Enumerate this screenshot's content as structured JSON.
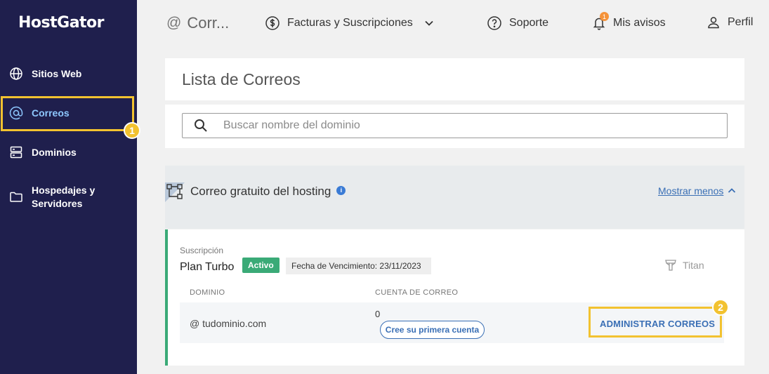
{
  "sidebar": {
    "logo": "HostGator",
    "items": [
      {
        "label": "Sitios Web",
        "icon": "globe-icon"
      },
      {
        "label": "Correos",
        "icon": "at-icon",
        "active": true
      },
      {
        "label": "Dominios",
        "icon": "server-icon"
      },
      {
        "label": "Hospedajes y\nServidores",
        "icon": "folder-icon"
      }
    ]
  },
  "topbar": {
    "title": "Corr...",
    "facturas": "Facturas y Suscripciones",
    "soporte": "Soporte",
    "avisos": "Mis avisos",
    "avisos_count": "1",
    "perfil": "Perfil"
  },
  "main": {
    "title": "Lista de Correos",
    "search_placeholder": "Buscar nombre del dominio",
    "section": {
      "title": "Correo gratuito del hosting",
      "toggle": "Mostrar menos"
    },
    "plan": {
      "subscription_label": "Suscripción",
      "name": "Plan Turbo",
      "status": "Activo",
      "expiry": "Fecha de Vencimiento: 23/11/2023",
      "provider": "Titan",
      "columns": [
        "DOMINIO",
        "CUENTA DE CORREO"
      ],
      "rows": [
        {
          "domain": "@ tudominio.com",
          "count": "0",
          "create_label": "Cree su primera cuenta",
          "action": "ADMINISTRAR CORREOS"
        }
      ]
    }
  },
  "annotations": {
    "step1": "1",
    "step2": "2"
  },
  "colors": {
    "sidebar": "#1f1f4d",
    "highlight": "#f2c230",
    "active_green": "#3aaa77",
    "link_blue": "#3a6fb5"
  }
}
